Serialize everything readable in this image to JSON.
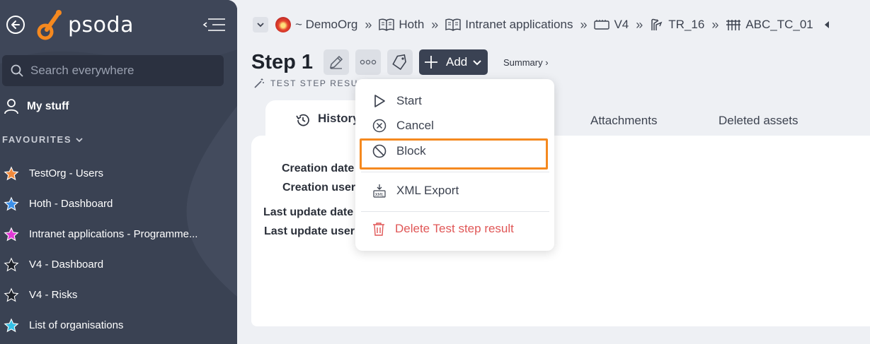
{
  "sidebar": {
    "logo_text": "psoda",
    "search_placeholder": "Search everywhere",
    "my_stuff": "My stuff",
    "favourites_heading": "FAVOURITES",
    "favourites": [
      {
        "label": "TestOrg - Users",
        "star_color": "#f08a3c"
      },
      {
        "label": "Hoth - Dashboard",
        "star_color": "#3b8fe8"
      },
      {
        "label": "Intranet applications - Programme...",
        "star_color": "#e23ad6"
      },
      {
        "label": "V4 - Dashboard",
        "star_color": "#1f232b"
      },
      {
        "label": "V4 - Risks",
        "star_color": "#1f232b"
      },
      {
        "label": "List of organisations",
        "star_color": "#35c1e6"
      }
    ]
  },
  "breadcrumb": [
    {
      "label": "~ DemoOrg",
      "icon": "org-logo-icon"
    },
    {
      "label": "Hoth",
      "icon": "book-icon"
    },
    {
      "label": "Intranet applications",
      "icon": "book-icon"
    },
    {
      "label": "V4",
      "icon": "folder-icon"
    },
    {
      "label": "TR_16",
      "icon": "test-run-icon"
    },
    {
      "label": "ABC_TC_01",
      "icon": "test-case-icon"
    }
  ],
  "page": {
    "title": "Step 1",
    "subtitle": "TEST STEP RESULT",
    "add_label": "Add",
    "summary_link": "Summary ›"
  },
  "tabs": {
    "history": "History",
    "attachments": "Attachments",
    "deleted_assets": "Deleted assets"
  },
  "fields": {
    "creation_date": "Creation date",
    "creation_user": "Creation user",
    "last_update_date": "Last update date",
    "last_update_user": "Last update user"
  },
  "menu": {
    "start": "Start",
    "cancel": "Cancel",
    "block": "Block",
    "xml_export": "XML Export",
    "delete": "Delete Test step result"
  },
  "colors": {
    "sidebar_bg": "#3a4253",
    "accent_orange": "#f5891f",
    "danger": "#e05757"
  }
}
